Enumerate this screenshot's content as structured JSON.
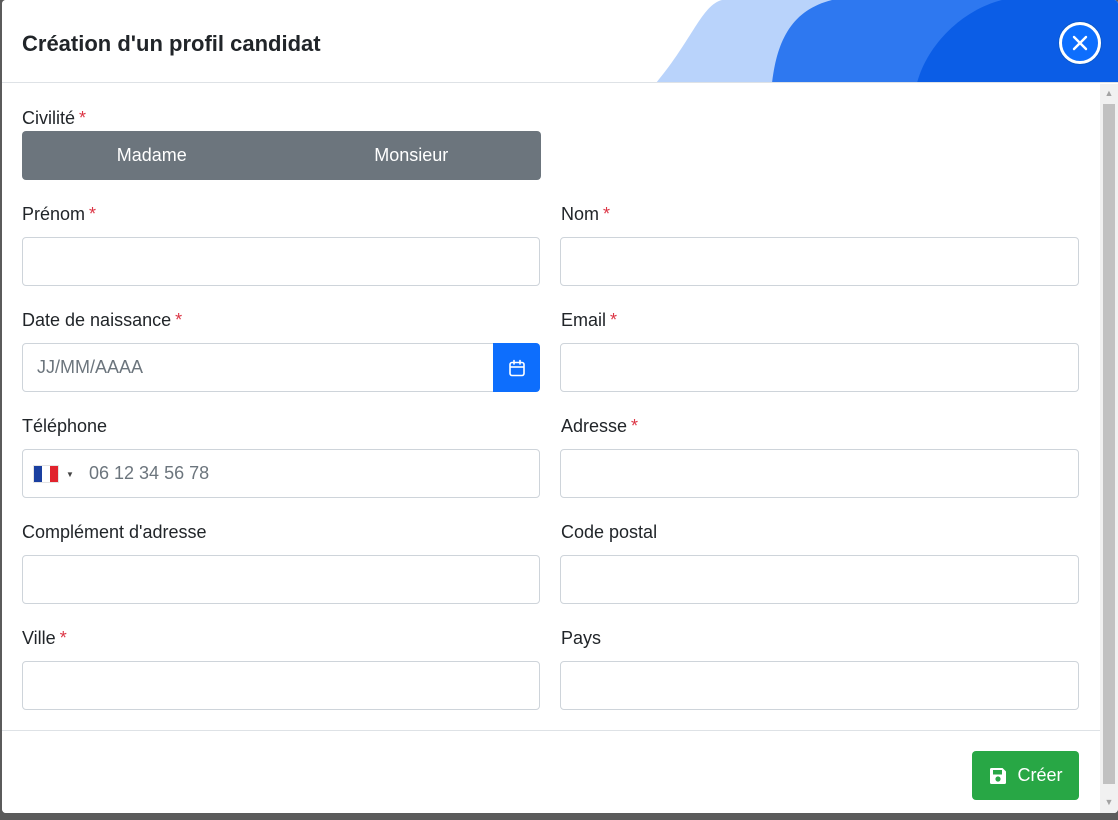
{
  "modal": {
    "title": "Création d'un profil candidat",
    "close_icon": "close-icon",
    "colors": {
      "primary": "#0d6efd",
      "success": "#28a745",
      "secondary": "#6c757d",
      "required": "#dc3545"
    }
  },
  "form": {
    "civility": {
      "label": "Civilité",
      "required_mark": "*",
      "options": [
        "Madame",
        "Monsieur"
      ]
    },
    "first_name": {
      "label": "Prénom",
      "required_mark": "*",
      "value": ""
    },
    "last_name": {
      "label": "Nom",
      "required_mark": "*",
      "value": ""
    },
    "birth_date": {
      "label": "Date de naissance",
      "required_mark": "*",
      "placeholder": "JJ/MM/AAAA",
      "icon": "calendar-icon"
    },
    "email": {
      "label": "Email",
      "required_mark": "*",
      "value": ""
    },
    "phone": {
      "label": "Téléphone",
      "placeholder": "06 12 34 56 78",
      "country_flag": "france-flag-icon"
    },
    "address": {
      "label": "Adresse",
      "required_mark": "*",
      "value": ""
    },
    "address_complement": {
      "label": "Complément d'adresse",
      "value": ""
    },
    "postal_code": {
      "label": "Code postal",
      "value": ""
    },
    "city": {
      "label": "Ville",
      "required_mark": "*",
      "value": ""
    },
    "country": {
      "label": "Pays",
      "value": ""
    }
  },
  "footer": {
    "create_label": "Créer",
    "create_icon": "save-icon"
  }
}
